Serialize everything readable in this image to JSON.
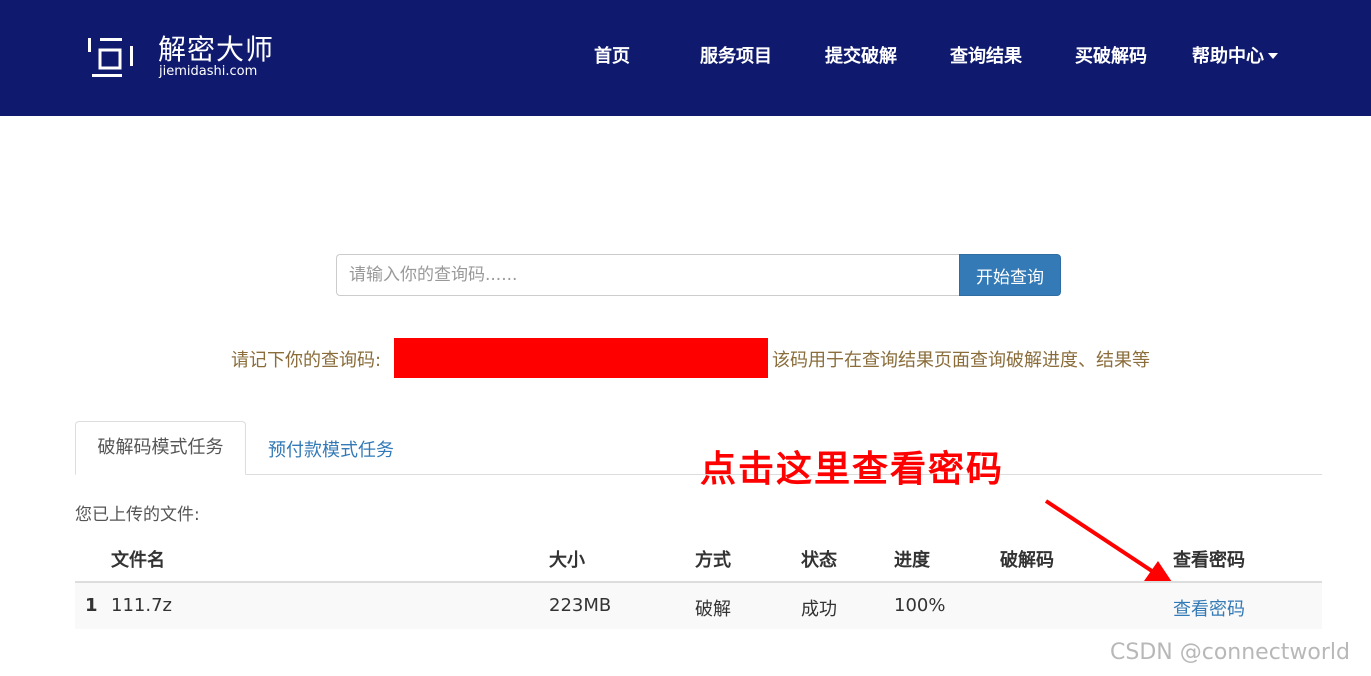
{
  "brand": {
    "name": "解密大师",
    "domain": "jiemidashi.com"
  },
  "nav": {
    "items": [
      {
        "label": "首页"
      },
      {
        "label": "服务项目"
      },
      {
        "label": "提交破解"
      },
      {
        "label": "查询结果"
      },
      {
        "label": "买破解码"
      },
      {
        "label": "帮助中心"
      }
    ]
  },
  "search": {
    "placeholder": "请输入你的查询码......",
    "button_label": "开始查询"
  },
  "notice": {
    "prefix": "请记下你的查询码:",
    "suffix": "该码用于在查询结果页面查询破解进度、结果等"
  },
  "tabs": [
    {
      "label": "破解码模式任务",
      "active": true
    },
    {
      "label": "预付款模式任务",
      "active": false
    }
  ],
  "annotation": {
    "text": "点击这里查看密码",
    "color": "#ff0000"
  },
  "files": {
    "label": "您已上传的文件:",
    "columns": [
      "文件名",
      "大小",
      "方式",
      "状态",
      "进度",
      "破解码",
      "查看密码"
    ],
    "rows": [
      {
        "index": "1",
        "name": "111.7z",
        "size": "223MB",
        "method": "破解",
        "status": "成功",
        "progress": "100%",
        "code": "",
        "action": "查看密码"
      }
    ]
  },
  "watermark": "CSDN @connectworld",
  "colors": {
    "navbar": "#0f1a6e",
    "primary": "#337ab7",
    "notice": "#8a6d3b",
    "redaction": "#ff0000"
  }
}
